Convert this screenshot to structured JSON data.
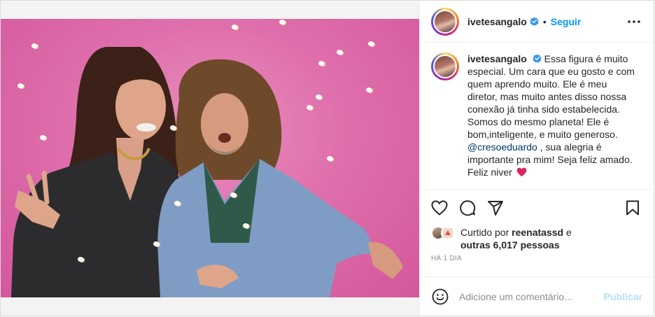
{
  "post": {
    "username": "ivetesangalo",
    "follow_label": "Seguir",
    "dot": "•",
    "caption": {
      "username": "ivetesangalo",
      "text_before_mention": "Essa figura é muito especial. Um cara que eu gosto e com quem aprendo muito. Ele é meu diretor, mas muito antes disso nossa conexão já tinha sido estabelecida. Somos do mesmo planeta! Ele é bom,inteligente, e muito generoso.",
      "mention": "@cresoeduardo",
      "text_after_mention": ", sua alegria é importante pra mim! Seja feliz amado. Feliz niver"
    },
    "likes": {
      "prefix": "Curtido por",
      "user": "reenatassd",
      "connector": "e",
      "others": "outras 6,017 pessoas"
    },
    "time_ago": "HÁ 1 DIA",
    "comment": {
      "placeholder": "Adicione um comentário...",
      "publish_label": "Publicar"
    }
  },
  "icons": {
    "verified": "verified-badge-icon",
    "more": "more-options-icon",
    "like": "heart-icon",
    "comment": "comment-icon",
    "share": "share-icon",
    "save": "bookmark-icon",
    "emoji": "emoji-icon"
  },
  "colors": {
    "accent": "#0095f6",
    "publish_disabled": "#b2dffc",
    "mention": "#00376b",
    "background_pink": "#df6fac",
    "heart_red": "#e0245e"
  }
}
